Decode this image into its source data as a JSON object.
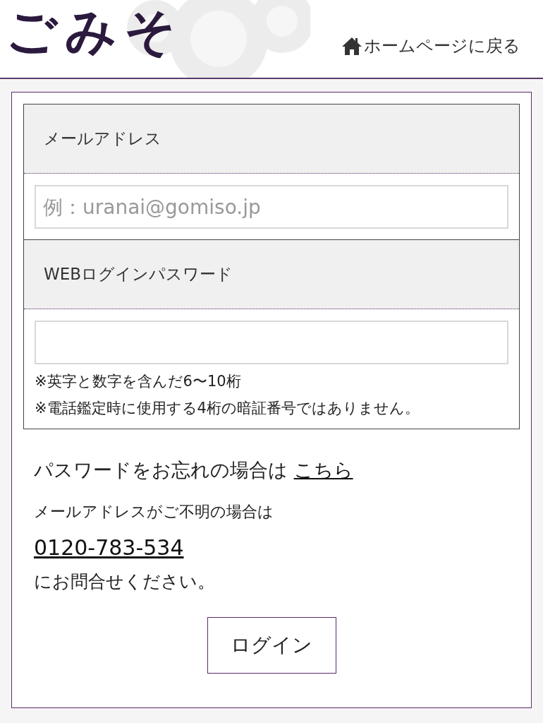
{
  "header": {
    "logo": "ごみそ",
    "home_link": "ホームページに戻る"
  },
  "form": {
    "fields": [
      {
        "label": "メールアドレス",
        "placeholder": "例：uranai@gomiso.jp"
      },
      {
        "label": "WEBログインパスワード",
        "notes": [
          "※英字と数字を含んだ6〜10桁",
          "※電話鑑定時に使用する4桁の暗証番号ではありません。"
        ]
      }
    ]
  },
  "help": {
    "forgot_text": "パスワードをお忘れの場合は",
    "forgot_link": "こちら",
    "unknown_text": "メールアドレスがご不明の場合は",
    "phone": "0120-783-534",
    "contact_text": "にお問合せください。"
  },
  "login_button": "ログイン"
}
